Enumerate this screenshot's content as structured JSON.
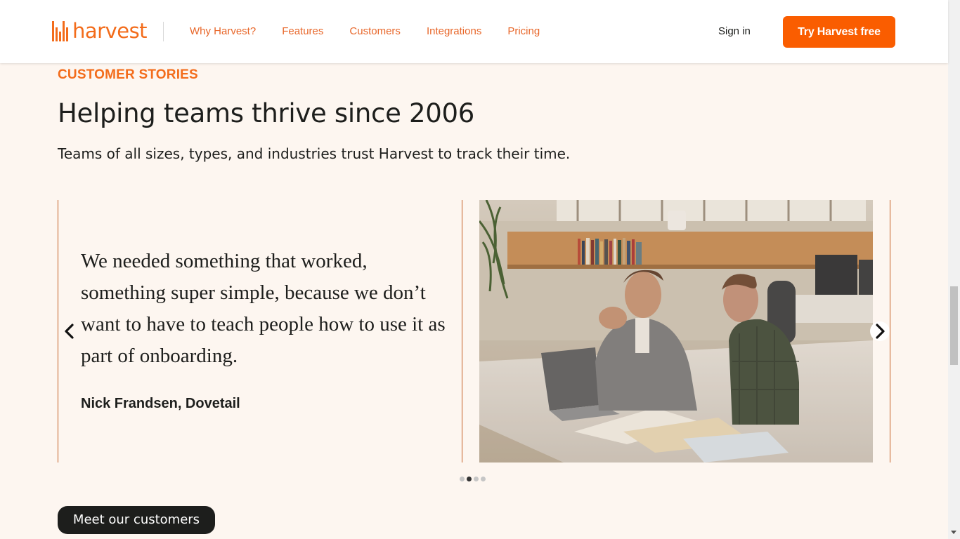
{
  "header": {
    "logo_text": "harvest",
    "nav": [
      "Why Harvest?",
      "Features",
      "Customers",
      "Integrations",
      "Pricing"
    ],
    "signin": "Sign in",
    "cta": "Try Harvest free",
    "accent_color": "#fa5d00"
  },
  "section": {
    "eyebrow": "CUSTOMER STORIES",
    "headline": "Helping teams thrive since 2006",
    "subhead": "Teams of all sizes, types, and industries trust Harvest to track their time."
  },
  "carousel": {
    "quote": "We needed something that worked, something super simple, because we don’t want to have to teach people how to use it as part of onboarding.",
    "author": "Nick Frandsen, Dovetail",
    "prev_icon": "chevron-left-icon",
    "next_icon": "chevron-right-icon",
    "dot_count": 4,
    "active_dot": 2
  },
  "footer_button": "Meet our customers"
}
